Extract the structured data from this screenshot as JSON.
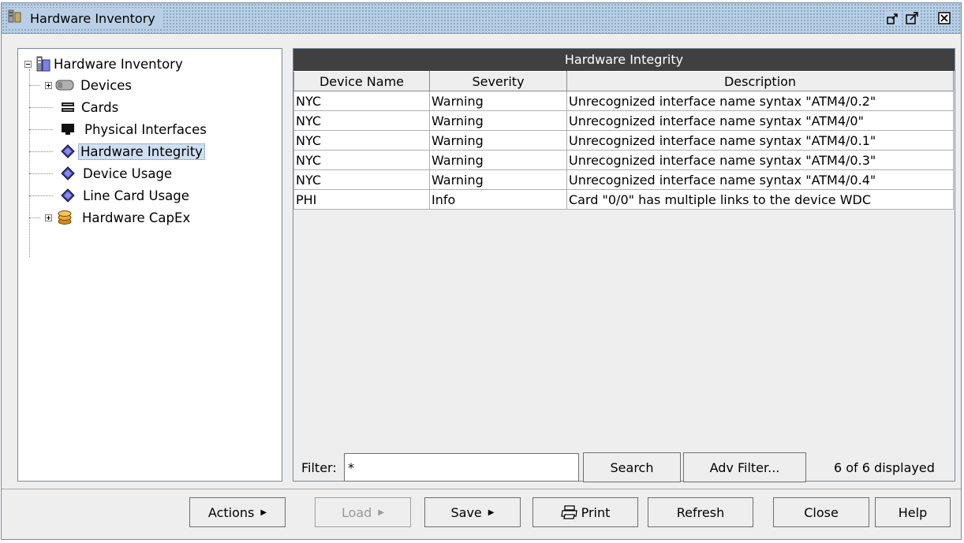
{
  "window": {
    "title": "Hardware Inventory",
    "icon": "hardware-inventory-icon",
    "controls": [
      "restore-icon",
      "maximize-icon",
      "close-icon"
    ]
  },
  "tree": {
    "root": "Hardware Inventory",
    "items": [
      {
        "label": "Devices",
        "icon": "devices-icon",
        "expandable": true
      },
      {
        "label": "Cards",
        "icon": "cards-icon",
        "expandable": false
      },
      {
        "label": "Physical Interfaces",
        "icon": "physical-interfaces-icon",
        "expandable": false
      },
      {
        "label": "Hardware Integrity",
        "icon": "report-icon",
        "expandable": false,
        "selected": true
      },
      {
        "label": "Device Usage",
        "icon": "report-icon",
        "expandable": false
      },
      {
        "label": "Line Card Usage",
        "icon": "report-icon",
        "expandable": false
      },
      {
        "label": "Hardware CapEx",
        "icon": "capex-icon",
        "expandable": true
      }
    ]
  },
  "report": {
    "title": "Hardware Integrity",
    "columns": [
      "Device Name",
      "Severity",
      "Description"
    ],
    "rows": [
      [
        "NYC",
        "Warning",
        "Unrecognized interface name syntax \"ATM4/0.2\""
      ],
      [
        "NYC",
        "Warning",
        "Unrecognized interface name syntax \"ATM4/0\""
      ],
      [
        "NYC",
        "Warning",
        "Unrecognized interface name syntax \"ATM4/0.1\""
      ],
      [
        "NYC",
        "Warning",
        "Unrecognized interface name syntax \"ATM4/0.3\""
      ],
      [
        "NYC",
        "Warning",
        "Unrecognized interface name syntax \"ATM4/0.4\""
      ],
      [
        "PHI",
        "Info",
        "Card \"0/0\" has multiple links to the device WDC"
      ]
    ]
  },
  "filter": {
    "label": "Filter:",
    "value": "*",
    "search_label": "Search",
    "adv_label": "Adv Filter...",
    "status": "6 of 6 displayed"
  },
  "buttons": {
    "actions": "Actions",
    "load": "Load",
    "save": "Save",
    "print": "Print",
    "refresh": "Refresh",
    "close": "Close",
    "help": "Help"
  },
  "colors": {
    "titlebar": "#b8cfe5",
    "table_header_bar": "#404040",
    "selection": "#d0dff2"
  }
}
